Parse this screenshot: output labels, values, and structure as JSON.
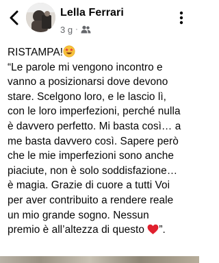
{
  "post_header": {
    "author_name": "Lella Ferrari",
    "timestamp": "3 g",
    "separator": "·",
    "privacy_icon": "friends-icon",
    "back_icon": "chevron-left-icon",
    "more_icon": "more-vertical-icon"
  },
  "post": {
    "line_1": "RISTAMPA!",
    "line_1_emoji": "star-struck-emoji",
    "line_2": "“Le parole mi vengono incontro e",
    "line_3": "vanno a posizionarsi dove devono",
    "line_4": "stare. Scelgono loro, e le lascio lì,",
    "line_5": "con le loro imperfezioni, perché nulla",
    "line_6": "è davvero perfetto. Mi basta così… a",
    "line_7": "me basta davvero così. Sapere però",
    "line_8": "che le mie imperfezioni sono anche",
    "line_9": "piaciute, non è solo soddisfazione…",
    "line_10": "è magia. Grazie di cuore a tutti Voi",
    "line_11": "per aver contribuito a rendere reale",
    "line_12": "un mio grande sogno. Nessun",
    "line_13_before": "premio è all’altezza di questo ",
    "line_13_emoji": "red-heart-emoji",
    "line_13_after": "”."
  },
  "colors": {
    "text": "#050505",
    "secondary_text": "#65676b",
    "heart": "#e0202e",
    "emoji_face": "#f7c23b"
  }
}
